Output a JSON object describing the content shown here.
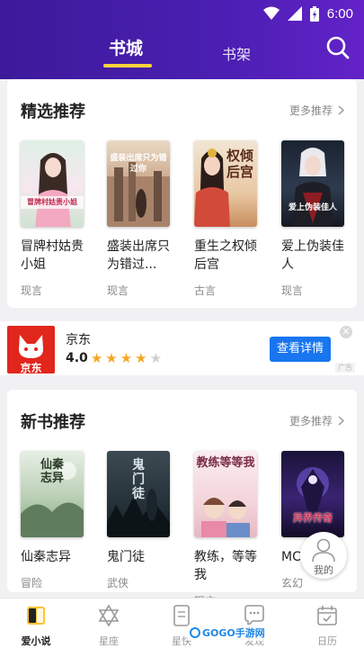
{
  "status": {
    "time": "6:00"
  },
  "header": {
    "tabs": [
      {
        "label": "书城"
      },
      {
        "label": "书架"
      }
    ]
  },
  "sections": [
    {
      "title": "精选推荐",
      "more": "更多推荐",
      "books": [
        {
          "title": "冒牌村姑贵小姐",
          "tag": "现言",
          "cover_text": "冒牌村姑贵小姐"
        },
        {
          "title": "盛装出席只为错过...",
          "tag": "现言",
          "cover_text": "盛装出席只为错过你"
        },
        {
          "title": "重生之权倾后宫",
          "tag": "古言",
          "cover_text": "权倾后宫"
        },
        {
          "title": "爱上伪装佳人",
          "tag": "现言",
          "cover_text": "爱上伪装佳人"
        }
      ]
    },
    {
      "title": "新书推荐",
      "more": "更多推荐",
      "books": [
        {
          "title": "仙秦志异",
          "tag": "冒险",
          "cover_text": "仙秦志异"
        },
        {
          "title": "鬼门徒",
          "tag": "武侠",
          "cover_text": "鬼门徒"
        },
        {
          "title": "教练，等等我",
          "tag": "现言",
          "cover_text": "教练等等我"
        },
        {
          "title": "MC传奇",
          "tag": "玄幻",
          "cover_text": "异界传奇"
        }
      ]
    }
  ],
  "ad": {
    "brand": "京东",
    "logo_text": "京东",
    "rating": "4.0",
    "stars": 4,
    "button": "查看详情",
    "badge": "广告"
  },
  "float_button": {
    "label": "我的"
  },
  "bottom_nav": [
    {
      "label": "爱小说",
      "active": true
    },
    {
      "label": "星座"
    },
    {
      "label": "星快"
    },
    {
      "label": "发现"
    },
    {
      "label": "日历"
    }
  ],
  "watermark": {
    "text": "GOGO手游网"
  },
  "colors": {
    "header_purple": "#4a1fb2",
    "tab_underline": "#ffd23c",
    "ad_button": "#1976f0",
    "jd_red": "#e1261c"
  }
}
